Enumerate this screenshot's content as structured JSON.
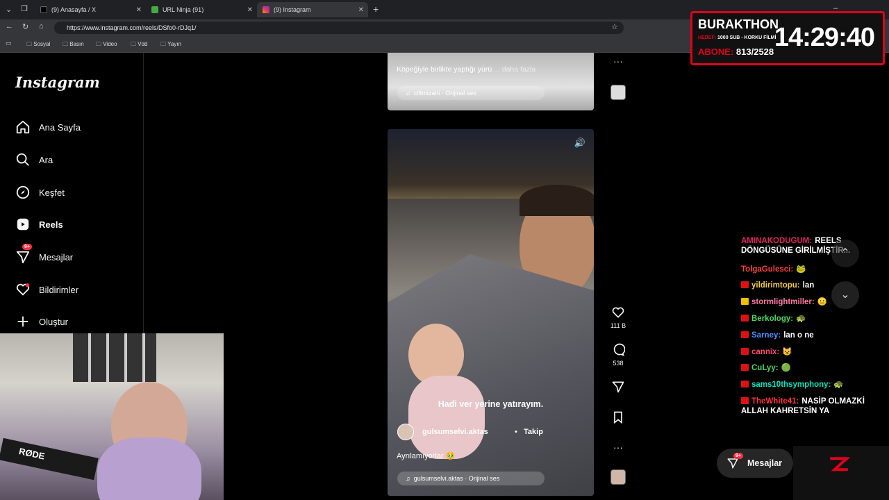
{
  "browser": {
    "tabs": [
      {
        "title": "(9) Anasayfa / X"
      },
      {
        "title": "URL Ninja (91)"
      },
      {
        "title": "(9) Instagram"
      }
    ],
    "url": "https://www.instagram.com/reels/DSfo0-rDJq1/",
    "bookmarks": [
      "Sosyal",
      "Basın",
      "Video",
      "Vdd",
      "Yayın"
    ]
  },
  "sidebar": {
    "logo": "Instagram",
    "items": [
      {
        "label": "Ana Sayfa",
        "icon": "home-icon"
      },
      {
        "label": "Ara",
        "icon": "search-icon"
      },
      {
        "label": "Keşfet",
        "icon": "compass-icon"
      },
      {
        "label": "Reels",
        "icon": "reels-icon"
      },
      {
        "label": "Mesajlar",
        "icon": "messenger-icon",
        "badge": "9+"
      },
      {
        "label": "Bildirimler",
        "icon": "heart-icon"
      },
      {
        "label": "Oluştur",
        "icon": "plus-icon"
      }
    ]
  },
  "reel_prev": {
    "caption": "Köpeğiyle birlikte yaptığı yürü",
    "more": "... daha fazla",
    "audio": "ciftmizahi · Orijinal ses"
  },
  "reel": {
    "subtitle": "Hadi ver yerine yatırayım.",
    "username": "gulsumselvi.aktas",
    "follow": "Takip",
    "caption": "Ayrılamıyorlar 🥹",
    "audio": "gulsumselvi.aktas · Orijinal ses",
    "likes": "111 B",
    "comments": "538"
  },
  "messages_button": {
    "label": "Mesajlar",
    "badge": "9+"
  },
  "stream_overlay": {
    "name": "BURAKTHON",
    "goal_label": "HEDEF:",
    "goal": "1000 SUB - KORKU FİLMİ",
    "sub_label": "ABONE:",
    "subs": "813/2528",
    "time": "14:29:40"
  },
  "chat": [
    {
      "user": "AMINAKODUGUM:",
      "text": "REELS DÖNGÜSÜNE GİRİLMİŞTİR...",
      "color": "#e0245e"
    },
    {
      "user": "TolgaGulesci:",
      "text": "🐸",
      "color": "#ff4040"
    },
    {
      "user": "yildirimtopu:",
      "text": "lan",
      "color": "#f2c94c"
    },
    {
      "user": "stormlightmiller:",
      "text": "😐",
      "color": "#ff7aa8"
    },
    {
      "user": "Berkology:",
      "text": "🐢",
      "color": "#4cd964"
    },
    {
      "user": "Sarney:",
      "text": "lan o ne",
      "color": "#4a90ff"
    },
    {
      "user": "cannix:",
      "text": "😼",
      "color": "#ff4d6d"
    },
    {
      "user": "CuLyy:",
      "text": "🟢",
      "color": "#4cd964"
    },
    {
      "user": "sams10thsymphony:",
      "text": "🐢",
      "color": "#00e5c0"
    },
    {
      "user": "TheWhite41:",
      "text": "NASİP OLMAZKİ ALLAH KAHRETSİN YA",
      "color": "#ff3040"
    }
  ]
}
